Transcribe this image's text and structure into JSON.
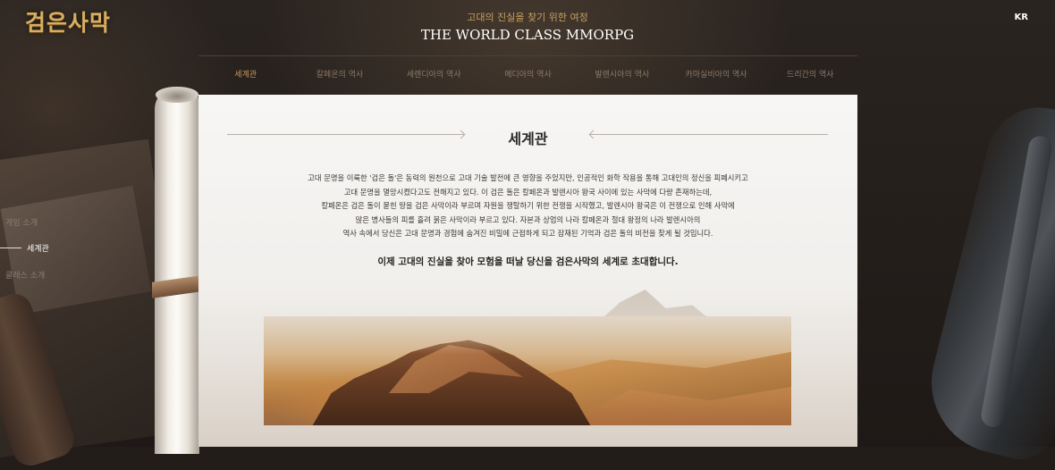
{
  "header": {
    "logo": "검은사막",
    "tagline": "고대의 진실을 찾기 위한 여정",
    "title": "THE WORLD CLASS MMORPG",
    "language": "KR"
  },
  "tabs": [
    {
      "label": "세계관",
      "active": true
    },
    {
      "label": "칼페온의 역사",
      "active": false
    },
    {
      "label": "세렌디아의 역사",
      "active": false
    },
    {
      "label": "메디아의 역사",
      "active": false
    },
    {
      "label": "발렌시아의 역사",
      "active": false
    },
    {
      "label": "카마실비아의 역사",
      "active": false
    },
    {
      "label": "드리간의 역사",
      "active": false
    }
  ],
  "sidebar": {
    "items": [
      {
        "label": "게임 소개",
        "active": false
      },
      {
        "label": "세계관",
        "active": true
      },
      {
        "label": "클래스 소개",
        "active": false
      }
    ]
  },
  "content": {
    "title": "세계관",
    "intro_lines": [
      "고대 문명을 이룩한 '검은 돌'은 동력의 원천으로 고대 기술 발전에 큰 영향을 주었지만, 인공적인 화학 작용을 통해 고대인의 정신을 피폐시키고",
      "고대 문명을 멸망시켰다고도 전해지고 있다. 이 검은 돌은 칼페온과 발렌시아 왕국 사이에 있는 사막에 다량 존재하는데,",
      "칼페온은 검은 돌이 묻힌 땅을 검은 사막이라 부르며 자원을 쟁탈하기 위한 전쟁을 시작했고, 발렌시아 왕국은 이 전쟁으로 인해 사막에",
      "많은 병사들의 피를 흘려 붉은 사막이라 부르고 있다. 자본과 상업의 나라 칼페온과 절대 왕정의 나라 발렌시아의",
      "역사 속에서 당신은 고대 문명과 경험에 숨겨진 비밀에 근접하게 되고 잠재된 기억과 검은 돌의 비전을 찾게 될 것입니다."
    ],
    "invite": "이제 고대의 진실을 찾아 모험을 떠날 당신을 검은사막의 세계로 초대합니다."
  },
  "colors": {
    "accent_gold": "#c99a5e",
    "background": "#231d19",
    "paper": "#f3f1ee"
  }
}
